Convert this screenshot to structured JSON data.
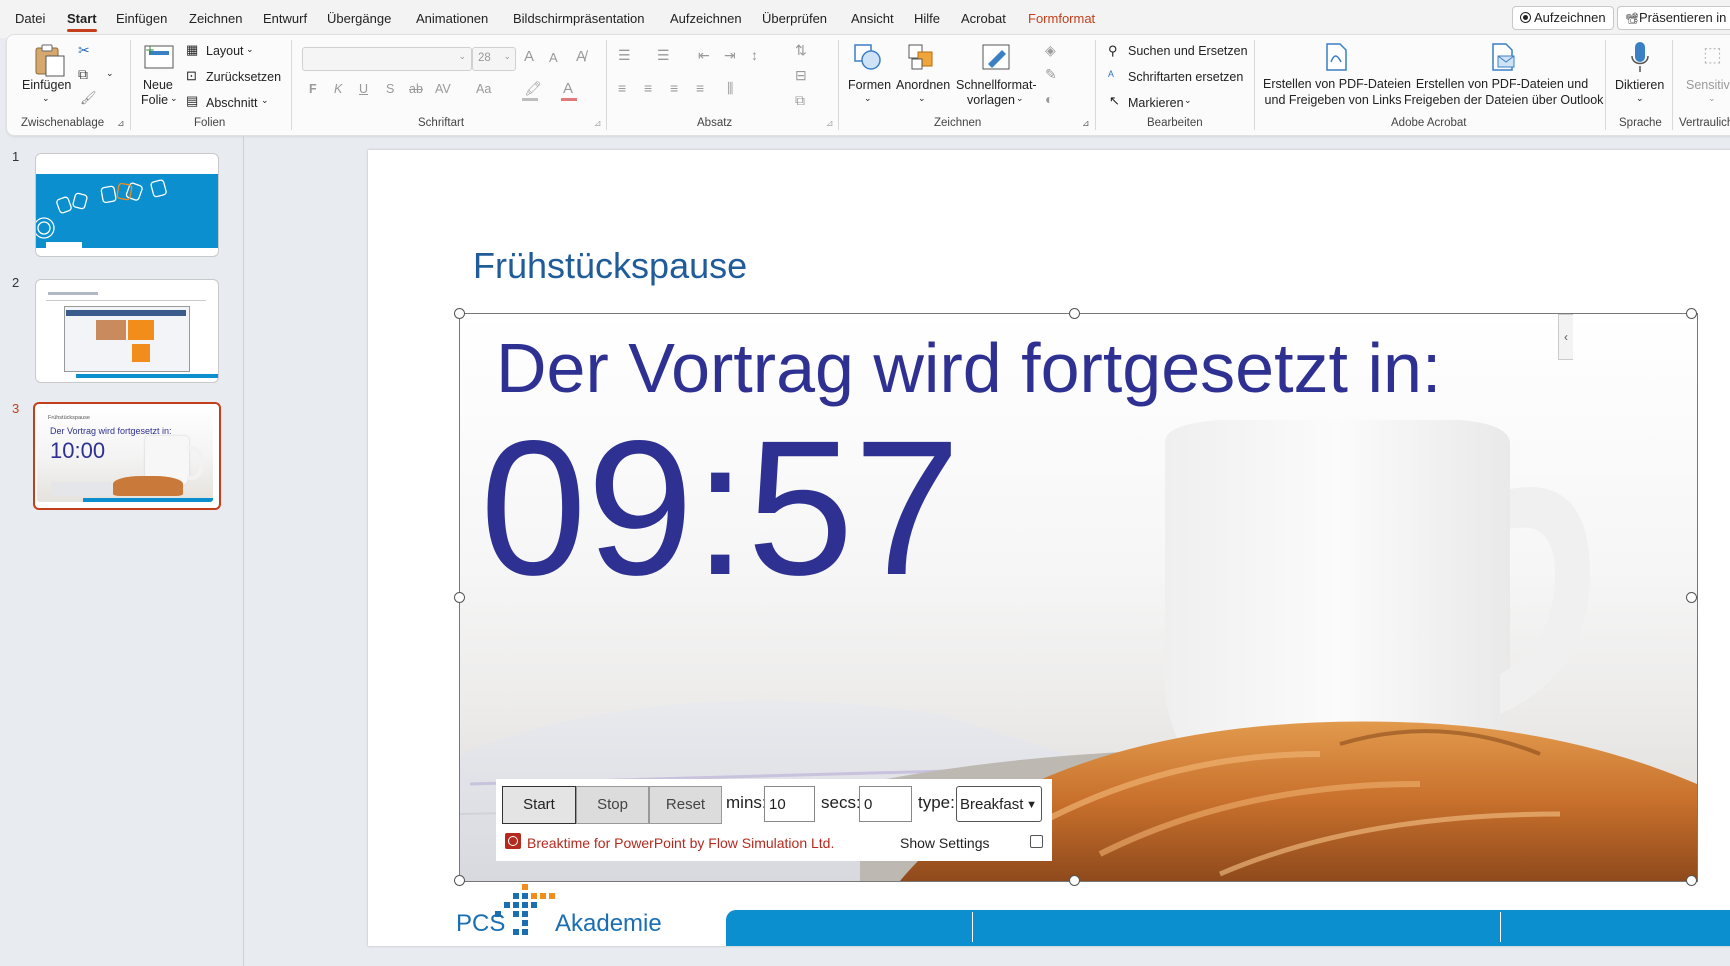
{
  "menu": {
    "tabs": [
      "Datei",
      "Start",
      "Einfügen",
      "Zeichnen",
      "Entwurf",
      "Übergänge",
      "Animationen",
      "Bildschirmpräsentation",
      "Aufzeichnen",
      "Überprüfen",
      "Ansicht",
      "Hilfe",
      "Acrobat",
      "Formformat"
    ],
    "active_tab": "Start",
    "record_button": "Aufzeichnen",
    "present_button": "Präsentieren in T"
  },
  "ribbon": {
    "clipboard": {
      "paste": "Einfügen",
      "label": "Zwischenablage"
    },
    "slides": {
      "new_slide": "Neue",
      "new_slide_2": "Folie",
      "layout": "Layout",
      "reset": "Zurücksetzen",
      "section": "Abschnitt",
      "label": "Folien"
    },
    "font": {
      "size_value": "28",
      "bold": "F",
      "italic": "K",
      "underline": "U",
      "shadow": "S",
      "strike": "ab",
      "spacing": "AV",
      "case": "Aa",
      "grow": "A",
      "shrink": "A",
      "label": "Schriftart"
    },
    "paragraph": {
      "label": "Absatz"
    },
    "drawing": {
      "shapes": "Formen",
      "arrange": "Anordnen",
      "quick_styles": "Schnellformat-",
      "quick_styles_2": "vorlagen",
      "label": "Zeichnen"
    },
    "editing": {
      "find_replace": "Suchen und Ersetzen",
      "replace_fonts": "Schriftarten ersetzen",
      "select": "Markieren",
      "label": "Bearbeiten"
    },
    "acrobat": {
      "create_links_1": "Erstellen von PDF-Dateien",
      "create_links_2": "und Freigeben von Links",
      "create_outlook_1": "Erstellen von PDF-Dateien und",
      "create_outlook_2": "Freigeben der Dateien über Outlook",
      "label": "Adobe Acrobat"
    },
    "voice": {
      "dictate": "Diktieren",
      "label": "Sprache"
    },
    "sensitivity": {
      "button": "Sensitivi",
      "label": "Vertraulich"
    }
  },
  "thumbnails": {
    "numbers": [
      "1",
      "2",
      "3"
    ],
    "slide3_title": "Frühstückspause",
    "slide3_caption": "Der Vortrag wird fortgesetzt in:",
    "slide3_time": "10:00"
  },
  "slide": {
    "title": "Frühstückspause",
    "caption": "Der Vortrag wird fortgesetzt in:",
    "countdown": "09:57",
    "controls": {
      "start": "Start",
      "stop": "Stop",
      "reset": "Reset",
      "mins_label": "mins:",
      "mins_value": "10",
      "secs_label": "secs:",
      "secs_value": "0",
      "type_label": "type:",
      "type_value": "Breakfast",
      "credit": "Breaktime for PowerPoint by Flow Simulation Ltd.",
      "show_settings": "Show Settings"
    },
    "logo": {
      "pcs": "PCS",
      "akademie": "Akademie"
    }
  },
  "colors": {
    "accent": "#c43e1c",
    "slide_blue": "#2e3192",
    "footer_blue": "#0b8fcf",
    "logo_blue": "#1a6fb3",
    "logo_orange": "#f28c1b"
  }
}
